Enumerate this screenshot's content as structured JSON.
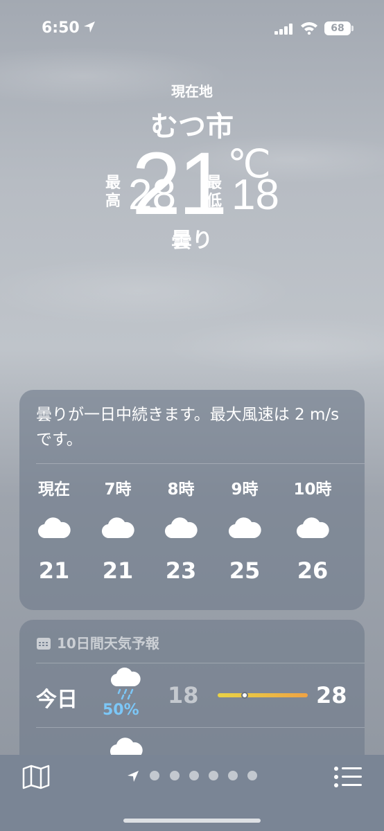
{
  "status_bar": {
    "time": "6:50",
    "battery": "68"
  },
  "hero": {
    "location_label": "現在地",
    "city": "むつ市",
    "temperature": "21",
    "unit": "℃",
    "high_label_1": "最",
    "high_label_2": "高",
    "high": "28",
    "low_label_1": "最",
    "low_label_2": "低",
    "low": "18",
    "condition": "曇り"
  },
  "hourly": {
    "summary": "曇りが一日中続きます。最大風速は 2 m/s です。",
    "hours": [
      {
        "label": "現在",
        "icon": "cloud-icon",
        "temp": "21"
      },
      {
        "label": "7時",
        "icon": "cloud-icon",
        "temp": "21"
      },
      {
        "label": "8時",
        "icon": "cloud-icon",
        "temp": "23"
      },
      {
        "label": "9時",
        "icon": "cloud-icon",
        "temp": "25"
      },
      {
        "label": "10時",
        "icon": "cloud-icon",
        "temp": "26"
      }
    ]
  },
  "forecast": {
    "header": "10日間天気予報",
    "days": [
      {
        "day": "今日",
        "icon": "cloud-rain-icon",
        "precip": "50%",
        "low": "18",
        "high": "28",
        "current_position": 0.3
      }
    ]
  },
  "colors": {
    "precip": "#7cc7f7",
    "bar_start": "#e9d246",
    "bar_end": "#efa244"
  }
}
